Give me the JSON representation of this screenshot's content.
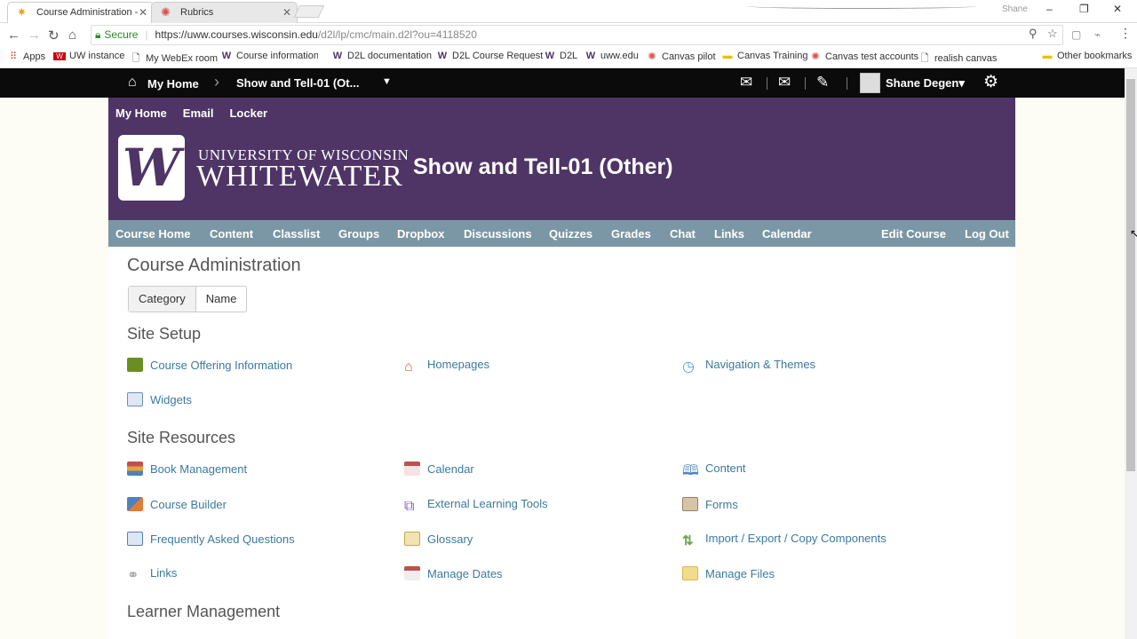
{
  "browser": {
    "tabs": [
      {
        "title": "Course Administration -"
      },
      {
        "title": "Rubrics"
      }
    ],
    "window_name": "Shane",
    "address": {
      "secure_label": "Secure",
      "url_host": "https://uww.courses.wisconsin.edu",
      "url_path": "/d2l/lp/cmc/main.d2l?ou=4118520"
    },
    "bookmarks": [
      {
        "label": "Apps"
      },
      {
        "label": "UW instance"
      },
      {
        "label": "My WebEx room"
      },
      {
        "label": "Course information l..."
      },
      {
        "label": "D2L documentation"
      },
      {
        "label": "D2L Course Request"
      },
      {
        "label": "D2L"
      },
      {
        "label": "uww.edu"
      },
      {
        "label": "Canvas pilot"
      },
      {
        "label": "Canvas Training"
      },
      {
        "label": "Canvas test accounts"
      },
      {
        "label": "realish canvas"
      },
      {
        "label": "Other bookmarks"
      }
    ]
  },
  "d2l": {
    "home_label": "My Home",
    "course_selector": "Show and Tell-01 (Ot...",
    "user_name": "Shane Degen"
  },
  "banner": {
    "mini_links": [
      "My Home",
      "Email",
      "Locker"
    ],
    "uni_line1": "UNIVERSITY OF WISCONSIN",
    "uni_line2": "WHITEWATER",
    "course_title": "Show and Tell-01 (Other)"
  },
  "course_nav": [
    "Course Home",
    "Content",
    "Classlist",
    "Groups",
    "Dropbox",
    "Discussions",
    "Quizzes",
    "Grades",
    "Chat",
    "Links",
    "Calendar",
    "Edit Course",
    "Log Out"
  ],
  "page": {
    "title": "Course Administration",
    "view_toggle": [
      "Category",
      "Name"
    ],
    "sections": [
      {
        "title": "Site Setup",
        "tools": [
          {
            "label": "Course Offering Information",
            "color": "#6b8e23"
          },
          {
            "label": "Homepages",
            "color": "#c8643c"
          },
          {
            "label": "Navigation & Themes",
            "color": "#5b9bd5"
          },
          {
            "label": "Widgets",
            "color": "#6c8ebf"
          }
        ]
      },
      {
        "title": "Site Resources",
        "tools": [
          {
            "label": "Book Management",
            "color": "#c0504d"
          },
          {
            "label": "Calendar",
            "color": "#c0504d"
          },
          {
            "label": "Content",
            "color": "#4f81bd"
          },
          {
            "label": "Course Builder",
            "color": "#e07b39"
          },
          {
            "label": "External Learning Tools",
            "color": "#7e57c2"
          },
          {
            "label": "Forms",
            "color": "#9c7e5a"
          },
          {
            "label": "Frequently Asked Questions",
            "color": "#4f81bd"
          },
          {
            "label": "Glossary",
            "color": "#c9a94a"
          },
          {
            "label": "Import / Export / Copy Components",
            "color": "#6aa84f"
          },
          {
            "label": "Links",
            "color": "#999999"
          },
          {
            "label": "Manage Dates",
            "color": "#c0504d"
          },
          {
            "label": "Manage Files",
            "color": "#e6c65c"
          }
        ]
      },
      {
        "title": "Learner Management",
        "tools": []
      }
    ]
  }
}
